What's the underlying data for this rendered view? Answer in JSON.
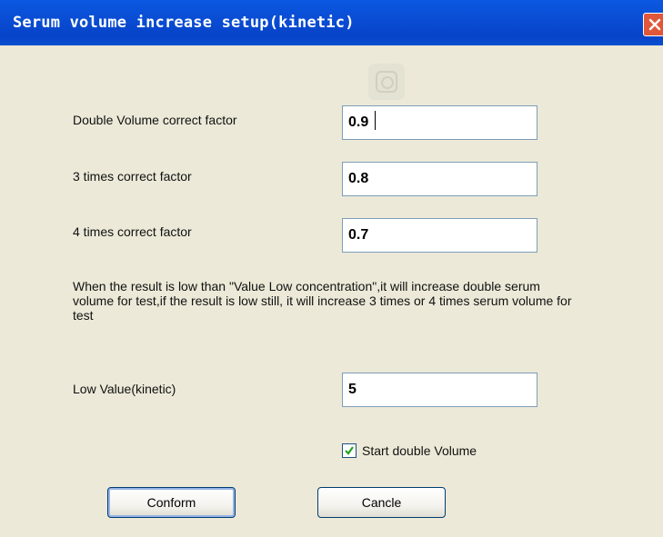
{
  "window": {
    "title": "Serum volume increase setup(kinetic)",
    "close_icon": "close-icon",
    "accent": "#0a4fd6"
  },
  "form": {
    "double_volume_label": "Double Volume correct factor",
    "double_volume_value": "0.9",
    "three_times_label": "3 times correct factor",
    "three_times_value": "0.8",
    "four_times_label": "4 times correct factor",
    "four_times_value": "0.7",
    "note": "When the result is low than \"Value Low concentration\",it will increase double serum volume for test,if the result is low still, it will increase 3 times or 4 times serum volume for test",
    "low_value_label": "Low Value(kinetic)",
    "low_value_value": "5",
    "start_double_label": "Start double Volume",
    "start_double_checked": true
  },
  "buttons": {
    "conform": "Conform",
    "cancle": "Cancle"
  }
}
